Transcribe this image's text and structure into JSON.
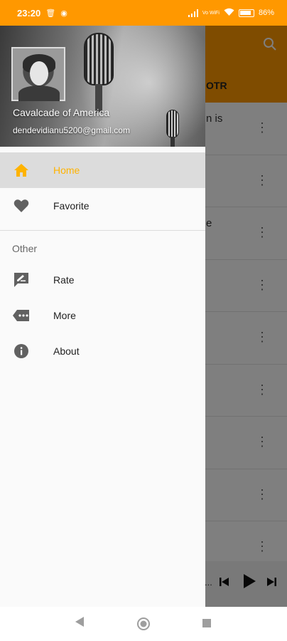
{
  "status_bar": {
    "time": "23:20",
    "network_label": "Vo WiFi",
    "battery_percent": "86%"
  },
  "background_app": {
    "tab_label": "OTR",
    "rows": [
      {
        "text": "n is"
      },
      {
        "text": ""
      },
      {
        "text": "e"
      },
      {
        "text": ""
      },
      {
        "text": ""
      },
      {
        "text": ""
      },
      {
        "text": ""
      },
      {
        "text": ""
      },
      {
        "text": ""
      }
    ],
    "player_text": "..."
  },
  "drawer": {
    "header": {
      "title": "Cavalcade of America",
      "email": "dendevidianu5200@gmail.com"
    },
    "items": [
      {
        "label": "Home",
        "icon": "home-icon",
        "active": true
      },
      {
        "label": "Favorite",
        "icon": "heart-icon",
        "active": false
      }
    ],
    "other_section_label": "Other",
    "other_items": [
      {
        "label": "Rate",
        "icon": "rate-icon"
      },
      {
        "label": "More",
        "icon": "more-icon"
      },
      {
        "label": "About",
        "icon": "info-icon"
      }
    ]
  },
  "colors": {
    "accent": "#ff9800",
    "active_text": "#ffb300",
    "icon_gray": "#616161",
    "active_bg": "#dcdcdc"
  }
}
